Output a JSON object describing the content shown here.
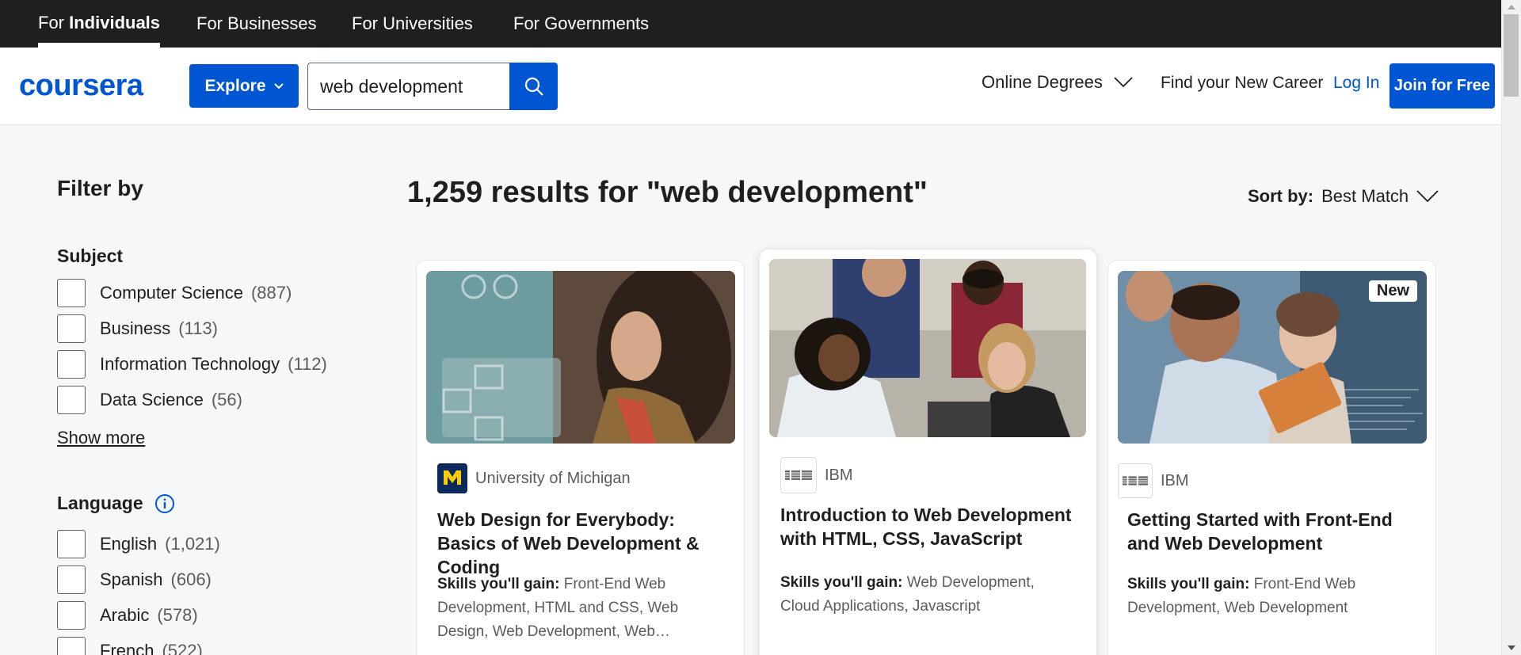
{
  "audience_tabs": [
    {
      "prefix": "For ",
      "bold": "Individuals"
    },
    {
      "label": "For Businesses"
    },
    {
      "label": "For Universities"
    },
    {
      "label": "For Governments"
    }
  ],
  "header": {
    "logo_text": "coursera",
    "explore_label": "Explore",
    "search_value": "web development",
    "degrees_label": "Online Degrees",
    "career_label": "Find your New Career",
    "login_label": "Log In",
    "join_label": "Join for Free"
  },
  "filters": {
    "title": "Filter by",
    "subject": {
      "title": "Subject",
      "items": [
        {
          "label": "Computer Science",
          "count": "(887)"
        },
        {
          "label": "Business",
          "count": "(113)"
        },
        {
          "label": "Information Technology",
          "count": "(112)"
        },
        {
          "label": "Data Science",
          "count": "(56)"
        }
      ],
      "show_more": "Show more"
    },
    "language": {
      "title": "Language",
      "items": [
        {
          "label": "English",
          "count": "(1,021)"
        },
        {
          "label": "Spanish",
          "count": "(606)"
        },
        {
          "label": "Arabic",
          "count": "(578)"
        },
        {
          "label": "French",
          "count": "(522)"
        }
      ]
    }
  },
  "results": {
    "title": "1,259 results for \"web development\"",
    "sort_prefix": "Sort by:",
    "sort_value": "Best Match"
  },
  "cards": [
    {
      "partner": "University of Michigan",
      "title": "Web Design for Everybody: Basics of Web Development & Coding",
      "skills_label": "Skills you'll gain:",
      "skills": "Front-End Web Development, HTML and CSS, Web Design, Web Development, Web…"
    },
    {
      "partner": "IBM",
      "title": "Introduction to Web Development with HTML, CSS, JavaScript",
      "skills_label": "Skills you'll gain:",
      "skills": "Web Development, Cloud Applications, Javascript"
    },
    {
      "partner": "IBM",
      "title": "Getting Started with Front-End and Web Development",
      "skills_label": "Skills you'll gain:",
      "skills": "Front-End Web Development, Web Development",
      "badge": "New"
    }
  ],
  "colors": {
    "brand_blue": "#0056d2",
    "topbar": "#1f1f1f",
    "page_bg": "#f5f7f8"
  }
}
